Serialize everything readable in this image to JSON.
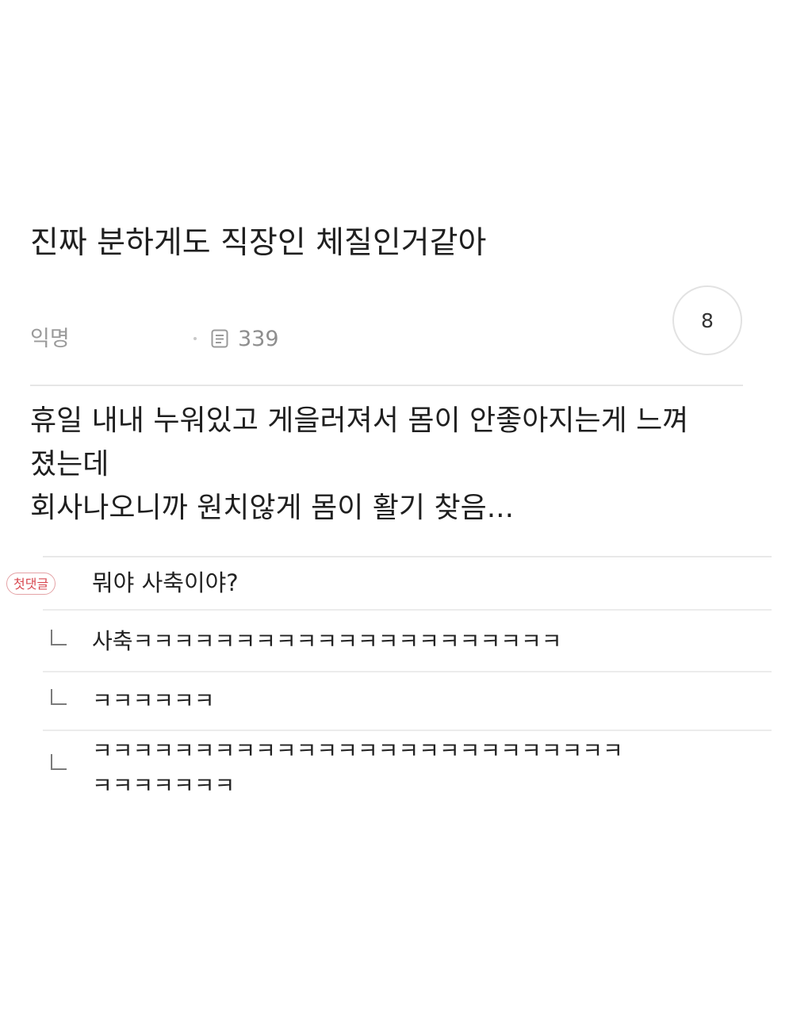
{
  "post": {
    "title": "진짜 분하게도 직장인 체질인거같아",
    "author": "익명",
    "views": "339",
    "likes": "8",
    "body_lines": [
      "휴일 내내 누워있고 게을러져서 몸이 안좋아지는게 느껴",
      "졌는데",
      "회사나오니까 원치않게 몸이 활기 찾음..."
    ]
  },
  "comments": {
    "first_badge": "첫댓글",
    "first_text": "뭐야 사축이야?",
    "replies": [
      {
        "lines": [
          "사축ㅋㅋㅋㅋㅋㅋㅋㅋㅋㅋㅋㅋㅋㅋㅋㅋㅋㅋㅋㅋㅋ"
        ]
      },
      {
        "lines": [
          "ㅋㅋㅋㅋㅋㅋ"
        ]
      },
      {
        "lines": [
          "ㅋㅋㅋㅋㅋㅋㅋㅋㅋㅋㅋㅋㅋㅋㅋㅋㅋㅋㅋㅋㅋㅋㅋㅋㅋㅋ",
          "ㅋㅋㅋㅋㅋㅋㅋ"
        ]
      }
    ]
  },
  "icons": {
    "views": "document-icon",
    "reply": "reply-arrow-icon"
  },
  "colors": {
    "badge": "#d84a52",
    "meta_text": "#9a9a9a",
    "divider": "#e6e6e6"
  }
}
